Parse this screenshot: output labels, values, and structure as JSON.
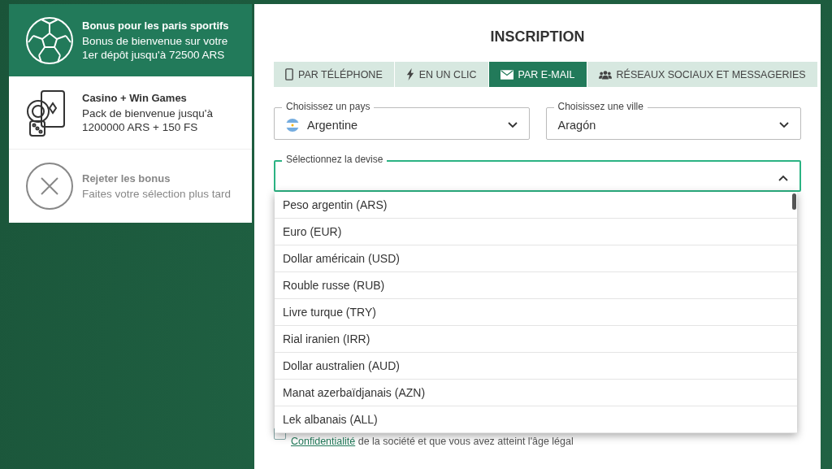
{
  "bonuses": [
    {
      "kind": "sport",
      "title": "Bonus pour les paris sportifs",
      "text": "Bonus de bienvenue sur votre 1er dépôt jusqu'à 72500 ARS",
      "selected": true,
      "disabled": false
    },
    {
      "kind": "casino",
      "title": "Casino + Win Games",
      "text": "Pack de bienvenue jusqu'à 1200000 ARS + 150 FS",
      "selected": false,
      "disabled": false
    },
    {
      "kind": "reject",
      "title": "Rejeter les bonus",
      "text": "Faites votre sélection plus tard",
      "selected": false,
      "disabled": true
    }
  ],
  "form": {
    "title": "INSCRIPTION",
    "tabs": [
      {
        "kind": "phone",
        "label": "PAR TÉLÉPHONE",
        "selected": false
      },
      {
        "kind": "bolt",
        "label": "EN UN CLIC",
        "selected": false
      },
      {
        "kind": "mail",
        "label": "PAR E-MAIL",
        "selected": true
      },
      {
        "kind": "people",
        "label": "RÉSEAUX SOCIAUX ET MESSAGERIES",
        "selected": false
      }
    ],
    "country": {
      "label": "Choisissez un pays",
      "value": "Argentine"
    },
    "city": {
      "label": "Choisissez une ville",
      "value": "Aragón"
    },
    "currency": {
      "label": "Sélectionnez la devise",
      "expanded": true,
      "options": [
        "Peso argentin (ARS)",
        "Euro (EUR)",
        "Dollar américain (USD)",
        "Rouble russe (RUB)",
        "Livre turque (TRY)",
        "Rial iranien (IRR)",
        "Dollar australien (AUD)",
        "Manat azerbaïdjanais (AZN)",
        "Lek albanais (ALL)"
      ]
    },
    "terms": {
      "checked": false,
      "link": "Confidentialité",
      "text": "de la société et que vous avez atteint l'âge légal"
    }
  }
}
